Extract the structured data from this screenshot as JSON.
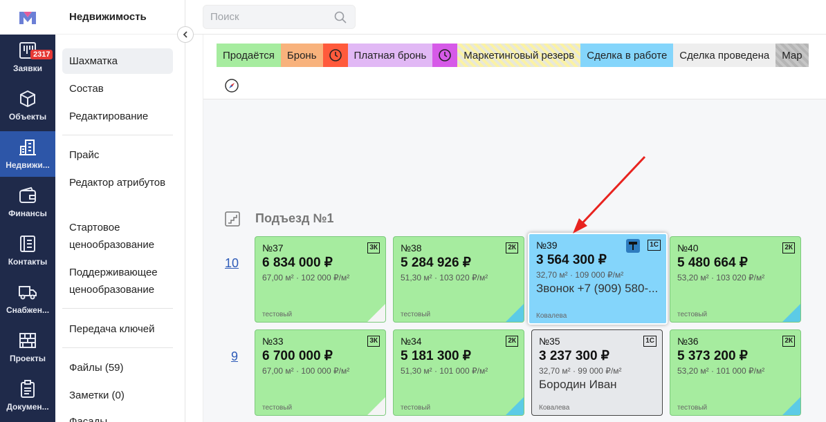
{
  "rail": {
    "items": [
      {
        "label": "Заявки",
        "icon": "requests-icon",
        "badge": "2317"
      },
      {
        "label": "Объекты",
        "icon": "cube-icon"
      },
      {
        "label": "Недвижи...",
        "icon": "building-icon",
        "active": true
      },
      {
        "label": "Финансы",
        "icon": "wallet-icon"
      },
      {
        "label": "Контакты",
        "icon": "contacts-icon"
      },
      {
        "label": "Снабжен...",
        "icon": "truck-icon"
      },
      {
        "label": "Проекты",
        "icon": "bricks-icon"
      },
      {
        "label": "Докумен...",
        "icon": "clipboard-icon"
      }
    ]
  },
  "sidebar": {
    "title": "Недвижимость",
    "items": [
      {
        "label": "Шахматка",
        "active": true
      },
      {
        "label": "Состав"
      },
      {
        "label": "Редактирование"
      },
      {
        "label": "Прайс"
      },
      {
        "label": "Редактор атрибутов"
      },
      {
        "label": "Стартовое ценообразование"
      },
      {
        "label": "Поддерживающее ценообразование"
      },
      {
        "label": "Передача ключей"
      },
      {
        "label": "Файлы (59)"
      },
      {
        "label": "Заметки (0)"
      },
      {
        "label": "Фасады"
      }
    ]
  },
  "search": {
    "placeholder": "Поиск"
  },
  "legend": [
    {
      "label": "Продаётся",
      "color": "#a6ec9f"
    },
    {
      "label": "Бронь",
      "color": "#f8b27c"
    },
    {
      "label": "",
      "icon": "clock-icon",
      "color": "#ff5a3c"
    },
    {
      "label": "Платная бронь",
      "color": "#e1b8f5"
    },
    {
      "label": "",
      "icon": "clock-icon",
      "color": "#d65ae8"
    },
    {
      "label": "Маркетинговый резерв",
      "color": "#fbf2a4"
    },
    {
      "label": "Сделка в работе",
      "color": "#84d5fb"
    },
    {
      "label": "Сделка проведена",
      "color": "#eeeeee"
    },
    {
      "label": "Мар",
      "color": "#c6c6c6"
    }
  ],
  "entrance": {
    "title": "Подъезд №1"
  },
  "floors": [
    {
      "number": "10",
      "apartments": [
        {
          "num": "№37",
          "price": "6 834 000 ₽",
          "area": "67,00 м² · 102 000 ₽/м²",
          "client": "",
          "agent": "тестовый",
          "type": "3К",
          "status": "green"
        },
        {
          "num": "№38",
          "price": "5 284 926 ₽",
          "area": "51,30 м² · 103 020 ₽/м²",
          "client": "",
          "agent": "тестовый",
          "type": "2К",
          "status": "green"
        },
        {
          "num": "№39",
          "price": "3 564 300 ₽",
          "area": "32,70 м² · 109 000 ₽/м²",
          "client": "Звонок +7 (909) 580-...",
          "agent": "Ковалева",
          "type": "1С",
          "status": "blue"
        },
        {
          "num": "№40",
          "price": "5 480 664 ₽",
          "area": "53,20 м² · 103 020 ₽/м²",
          "client": "",
          "agent": "тестовый",
          "type": "2К",
          "status": "green"
        }
      ]
    },
    {
      "number": "9",
      "apartments": [
        {
          "num": "№33",
          "price": "6 700 000 ₽",
          "area": "67,00 м² · 100 000 ₽/м²",
          "client": "",
          "agent": "тестовый",
          "type": "3К",
          "status": "green"
        },
        {
          "num": "№34",
          "price": "5 181 300 ₽",
          "area": "51,30 м² · 101 000 ₽/м²",
          "client": "",
          "agent": "тестовый",
          "type": "2К",
          "status": "green"
        },
        {
          "num": "№35",
          "price": "3 237 300 ₽",
          "area": "32,70 м² · 99 000 ₽/м²",
          "client": "Бородин Иван",
          "agent": "Ковалева",
          "type": "1С",
          "status": "grey"
        },
        {
          "num": "№36",
          "price": "5 373 200 ₽",
          "area": "53,20 м² · 101 000 ₽/м²",
          "client": "",
          "agent": "тестовый",
          "type": "2К",
          "status": "green"
        }
      ]
    }
  ]
}
